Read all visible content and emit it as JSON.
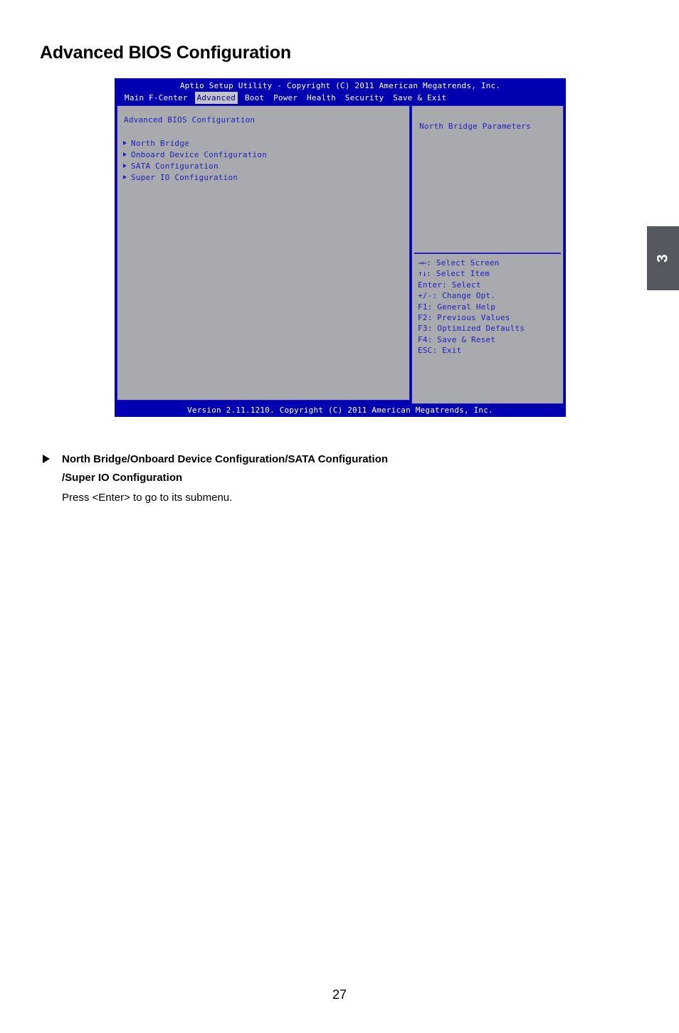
{
  "page": {
    "title": "Advanced BIOS Configuration",
    "number": "27",
    "chapter_tab": "3"
  },
  "bios": {
    "titlebar": "Aptio Setup Utility - Copyright (C) 2011 American Megatrends, Inc.",
    "menu_tabs": [
      {
        "label": "Main F-Center",
        "active": false
      },
      {
        "label": "Advanced",
        "active": true
      },
      {
        "label": "Boot",
        "active": false
      },
      {
        "label": "Power",
        "active": false
      },
      {
        "label": "Health",
        "active": false
      },
      {
        "label": "Security",
        "active": false
      },
      {
        "label": "Save & Exit",
        "active": false
      }
    ],
    "left_panel": {
      "heading": "Advanced BIOS Configuration",
      "items": [
        {
          "label": "North Bridge"
        },
        {
          "label": "Onboard Device Configuration"
        },
        {
          "label": "SATA Configuration"
        },
        {
          "label": "Super IO Configuration"
        }
      ]
    },
    "right_panel": {
      "help_text": "North Bridge Parameters",
      "nav_keys": [
        {
          "glyph": "→←",
          "text": ": Select Screen"
        },
        {
          "glyph": "↑↓",
          "text": ": Select Item"
        },
        {
          "glyph": "",
          "text": "Enter: Select"
        },
        {
          "glyph": "",
          "text": "+/-: Change Opt."
        },
        {
          "glyph": "",
          "text": "F1: General Help"
        },
        {
          "glyph": "",
          "text": "F2: Previous Values"
        },
        {
          "glyph": "",
          "text": "F3: Optimized Defaults"
        },
        {
          "glyph": "",
          "text": "F4: Save & Reset"
        },
        {
          "glyph": "",
          "text": "ESC: Exit"
        }
      ]
    },
    "footer": "Version 2.11.1210. Copyright (C) 2011 American Megatrends, Inc."
  },
  "note": {
    "heading_line1": "North Bridge/Onboard Device Configuration/SATA Configuration",
    "heading_line2": "/Super IO Configuration",
    "body": "Press <Enter> to go to its submenu."
  },
  "colors": {
    "bios_blue": "#0000b0",
    "panel_gray": "#a8aaae",
    "bios_text_blue": "#2020c0",
    "tab_highlight": "#c3c4c7",
    "chapter_tab_gray": "#54575e"
  }
}
